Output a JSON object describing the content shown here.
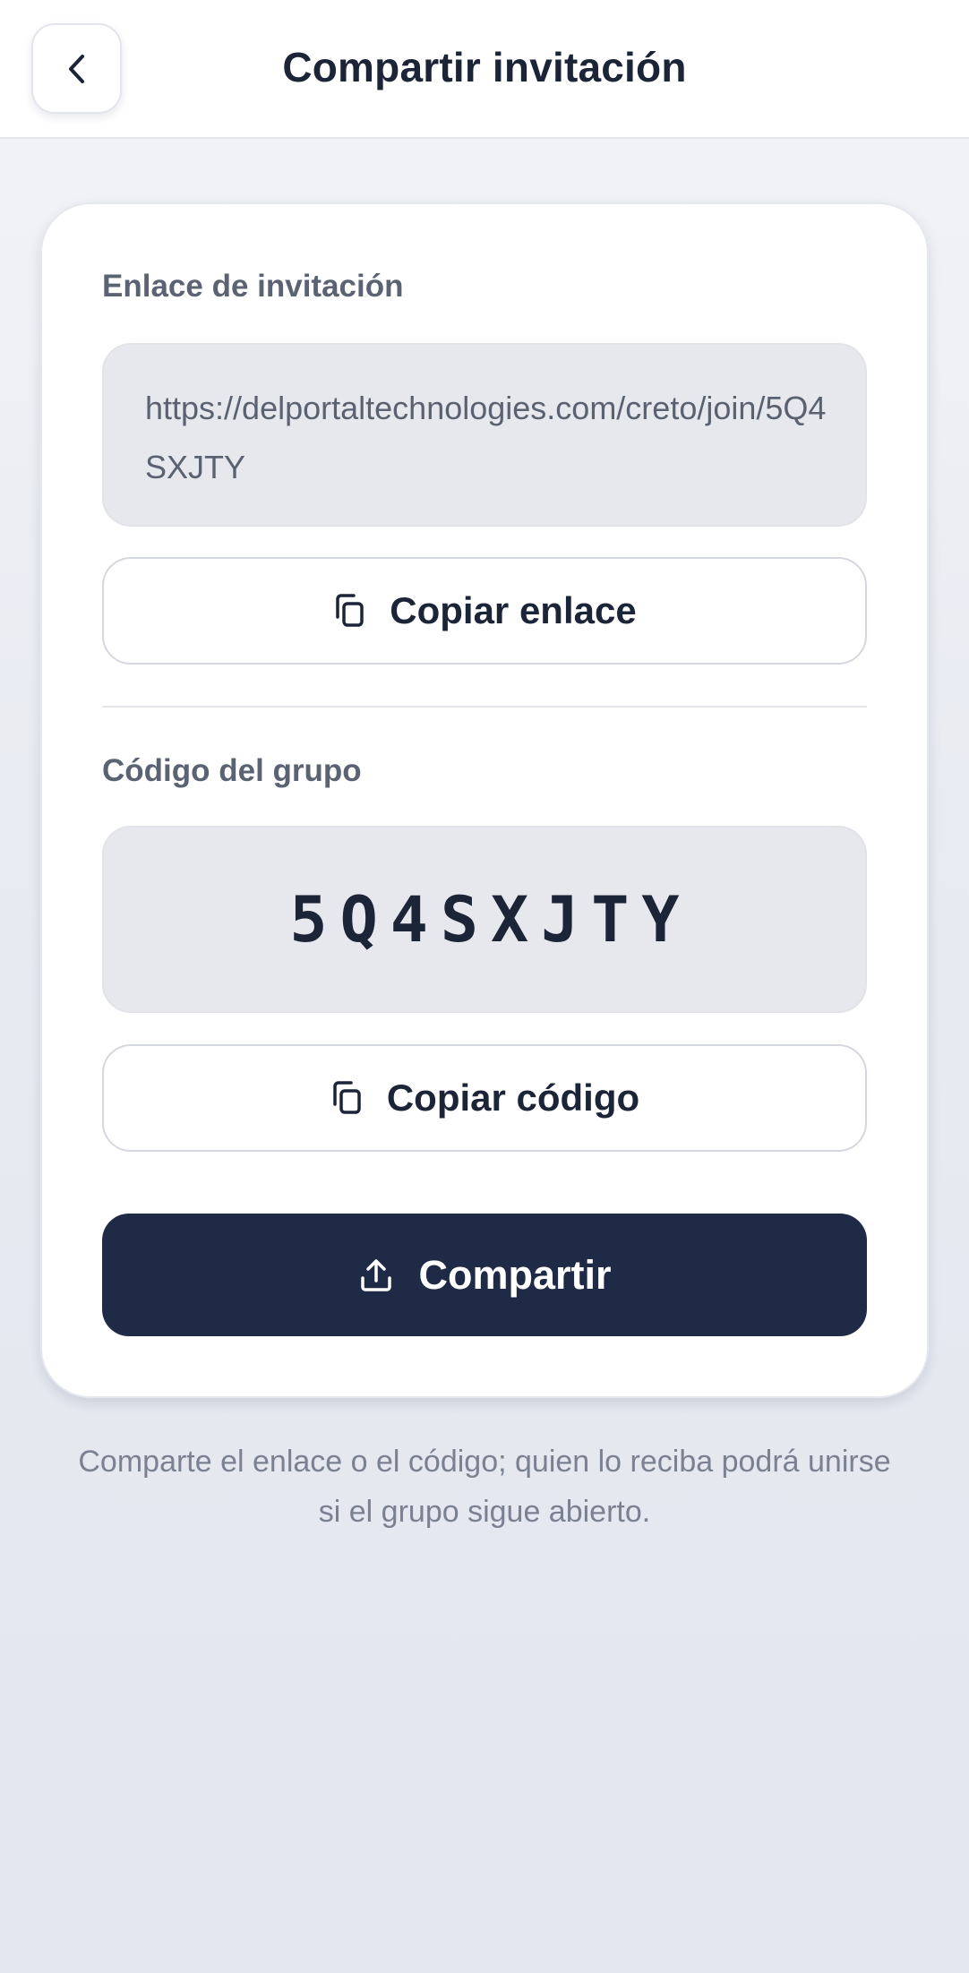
{
  "header": {
    "title": "Compartir invitación",
    "back_icon": "chevron-left-icon"
  },
  "invite_link": {
    "label": "Enlace de invitación",
    "value": "https://delportaltechnologies.com/creto/join/5Q4SXJTY",
    "copy_button_label": "Copiar enlace",
    "copy_icon": "copy-icon"
  },
  "group_code": {
    "label": "Código del grupo",
    "value": "5Q4SXJTY",
    "copy_button_label": "Copiar código",
    "copy_icon": "copy-icon"
  },
  "share": {
    "button_label": "Compartir",
    "icon": "share-upload-icon"
  },
  "footnote": "Comparte el enlace o el código; quien lo reciba podrá unirse si el grupo sigue abierto.",
  "colors": {
    "primary": "#1f2a47",
    "background": "#e3e6ef",
    "text": "#1c2438",
    "muted": "#7a8191"
  }
}
